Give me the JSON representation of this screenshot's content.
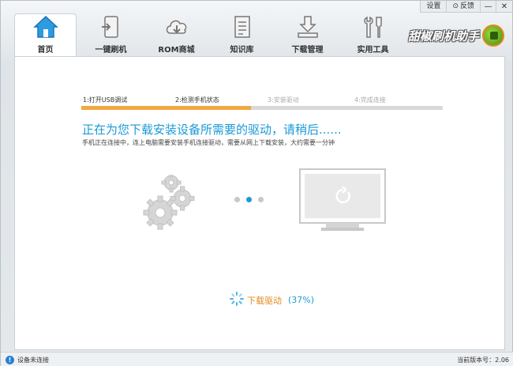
{
  "topbar": {
    "settings": "设置",
    "feedback": "反馈",
    "minimize": "—",
    "close": "✕"
  },
  "nav": [
    {
      "label": "首页",
      "icon": "home-icon",
      "active": true
    },
    {
      "label": "一键刷机",
      "icon": "flash-phone-icon"
    },
    {
      "label": "ROM商城",
      "icon": "cloud-download-icon"
    },
    {
      "label": "知识库",
      "icon": "document-icon"
    },
    {
      "label": "下载管理",
      "icon": "download-tray-icon"
    },
    {
      "label": "实用工具",
      "icon": "tools-icon"
    }
  ],
  "brand": {
    "name": "甜椒刷机助手"
  },
  "steps": [
    {
      "label": "1:打开USB调试",
      "state": "done"
    },
    {
      "label": "2:检测手机状态",
      "state": "current"
    },
    {
      "label": "3:安装驱动",
      "state": "todo"
    },
    {
      "label": "4:完成连接",
      "state": "todo"
    }
  ],
  "headline": "正在为您下载安装设备所需要的驱动，请稍后......",
  "subline": "手机正在连接中，连上电脑需要安装手机连接驱动，需要从网上下载安装，大约需要一分钟",
  "progress": {
    "label": "下载驱动",
    "percent_text": "(37%)",
    "percent": 37
  },
  "status": {
    "left": "设备未连接",
    "right": "当前版本号：2.06"
  },
  "colors": {
    "accent": "#1b9ad6",
    "orange": "#f0a940",
    "gray_bar": "#d9d9d9"
  }
}
